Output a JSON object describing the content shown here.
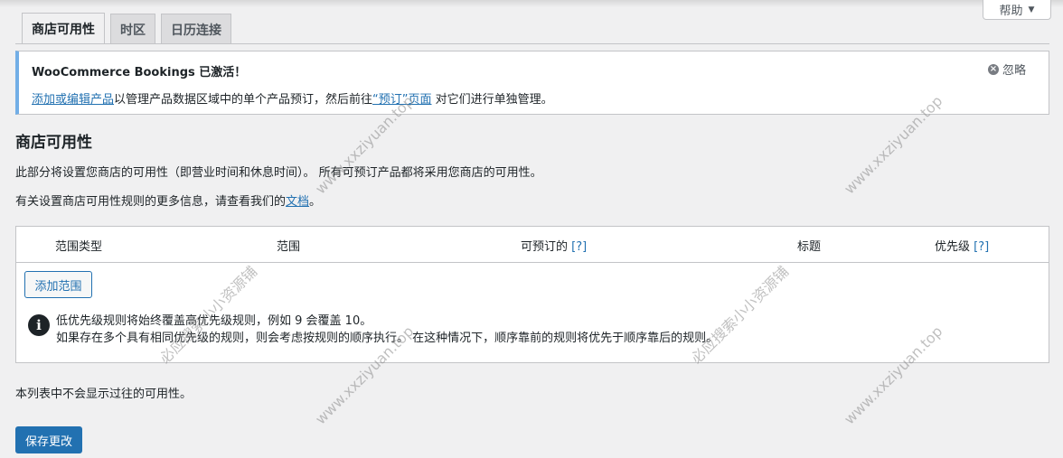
{
  "help_tab": {
    "label": "帮助"
  },
  "tabs": [
    {
      "label": "商店可用性",
      "active": true
    },
    {
      "label": "时区",
      "active": false
    },
    {
      "label": "日历连接",
      "active": false
    }
  ],
  "notice": {
    "title": "WooCommerce Bookings 已激活！",
    "link1": "添加或编辑产品",
    "text1": "以管理产品数据区域中的单个产品预订，然后前往",
    "link2": "“预订”页面",
    "text2": " 对它们进行单独管理。",
    "dismiss": "忽略"
  },
  "section": {
    "title": "商店可用性",
    "desc1": "此部分将设置您商店的可用性（即营业时间和休息时间）。 所有可预订产品都将采用您商店的可用性。",
    "desc2_text": "有关设置商店可用性规则的更多信息，请查看我们的",
    "desc2_link": "文档",
    "desc2_end": "。"
  },
  "table": {
    "columns": [
      "范围类型",
      "范围",
      "可预订的",
      "标题",
      "优先级"
    ],
    "help_marker": "[?]",
    "add_range_label": "添加范围",
    "info_line1": "低优先级规则将始终覆盖高优先级规则，例如 9 会覆盖 10。",
    "info_line2": "如果存在多个具有相同优先级的规则，则会考虑按规则的顺序执行。 在这种情况下，顺序靠前的规则将优先于顺序靠后的规则。"
  },
  "footer_note": "本列表中不会显示过往的可用性。",
  "save_button": "保存更改",
  "watermarks": [
    "www.xxziyuan.top",
    "必应搜索小小资源铺"
  ],
  "colors": {
    "accent": "#2271b1",
    "notice_border": "#72aee6"
  }
}
